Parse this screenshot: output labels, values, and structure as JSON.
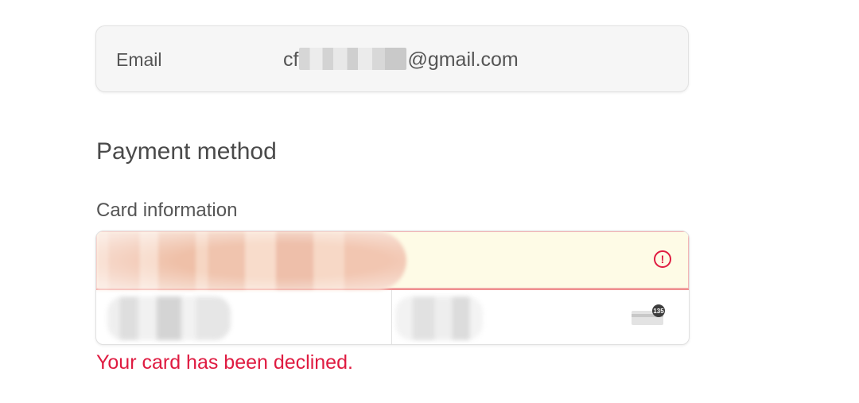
{
  "email": {
    "label": "Email",
    "value_prefix": "cf",
    "value_suffix": "@gmail.com"
  },
  "payment": {
    "section_title": "Payment method",
    "card_label": "Card information",
    "cvc_badge": "135",
    "error_message": "Your card has been declined."
  },
  "icons": {
    "error": "error-circle-icon",
    "cvc": "cvc-card-icon"
  },
  "colors": {
    "error": "#df1b41",
    "error_field_bg": "#fefbe6"
  }
}
